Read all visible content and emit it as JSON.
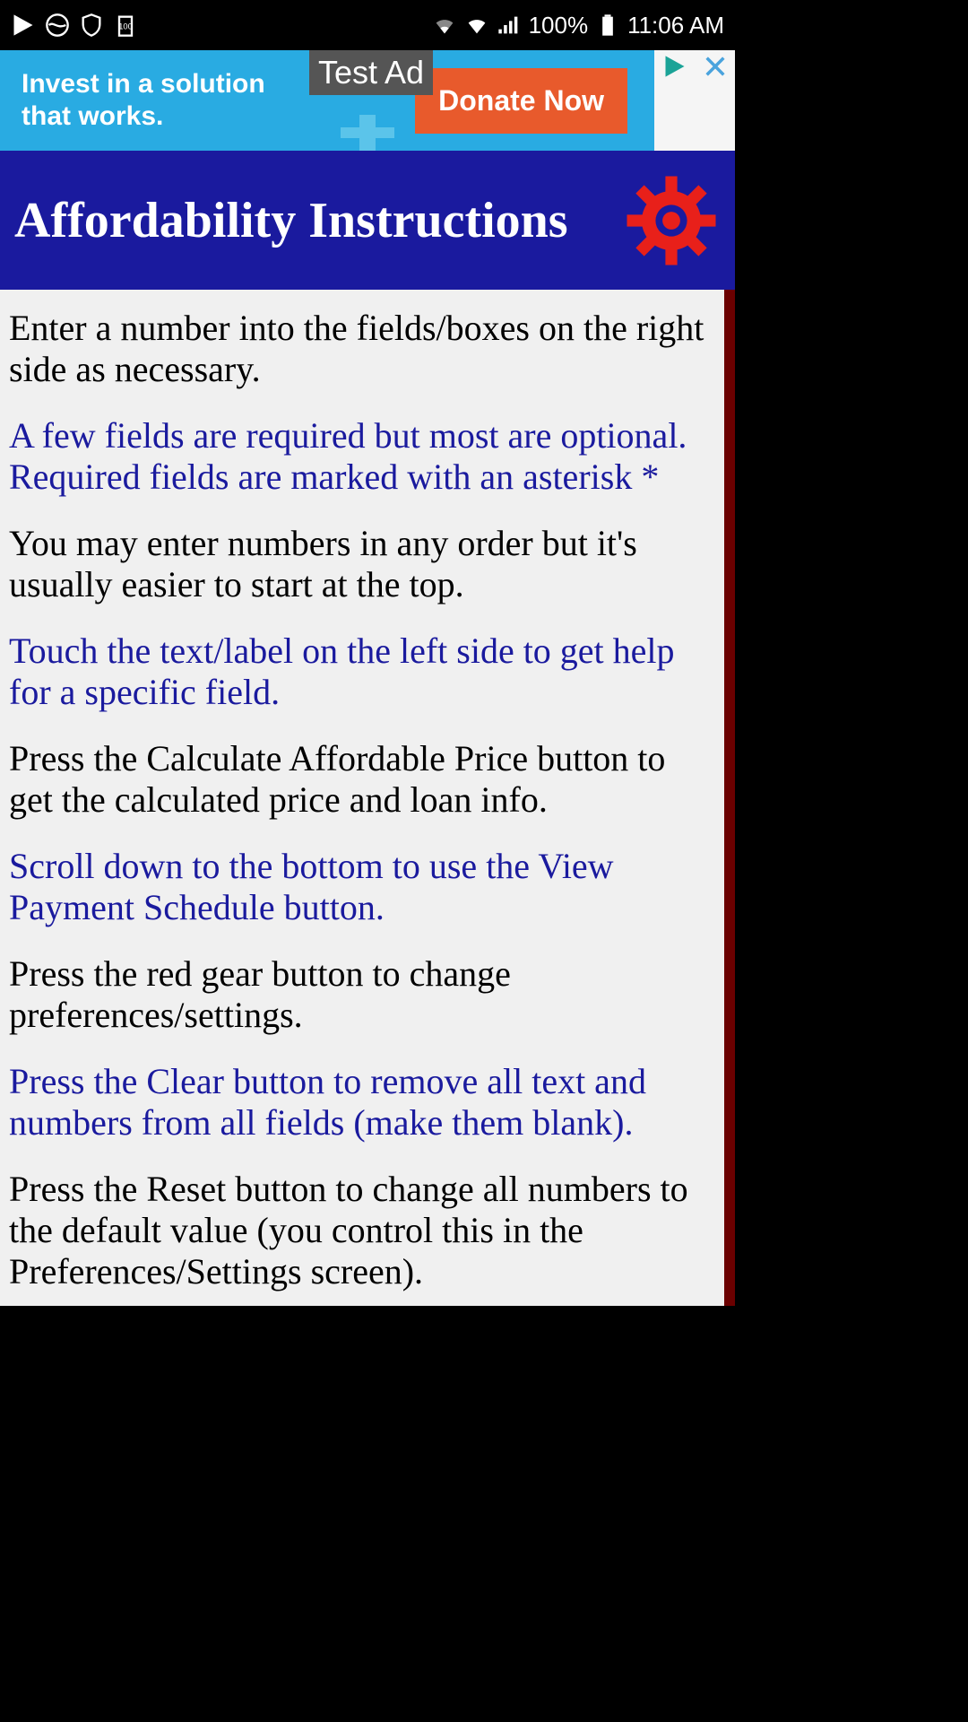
{
  "status_bar": {
    "battery_pct": "100%",
    "time": "11:06 AM"
  },
  "ad": {
    "text_line1": "Invest in a solution",
    "text_line2": "that works.",
    "label": "Test Ad",
    "button_label": "Donate Now"
  },
  "header": {
    "title": "Affordability Instructions"
  },
  "instructions": [
    {
      "text": "Enter a number into the fields/boxes on the right side as necessary.",
      "highlight": false
    },
    {
      "text": "A few fields are required but most are optional. Required fields are marked with an asterisk *",
      "highlight": true
    },
    {
      "text": "You may enter numbers in any order but it's usually easier to start at the top.",
      "highlight": false
    },
    {
      "text": "Touch the text/label on the left side to get help for a specific field.",
      "highlight": true
    },
    {
      "text": "Press the Calculate Affordable Price button to get the calculated price and loan info.",
      "highlight": false
    },
    {
      "text": "Scroll down to the bottom to use the View Payment Schedule button.",
      "highlight": true
    },
    {
      "text": "Press the red gear button to change preferences/settings.",
      "highlight": false
    },
    {
      "text": "Press the Clear button to remove all text and numbers from all fields (make them blank).",
      "highlight": true
    },
    {
      "text": "Press the Reset button to change all numbers to the default value (you control this in the Preferences/Settings screen).",
      "highlight": false
    }
  ]
}
